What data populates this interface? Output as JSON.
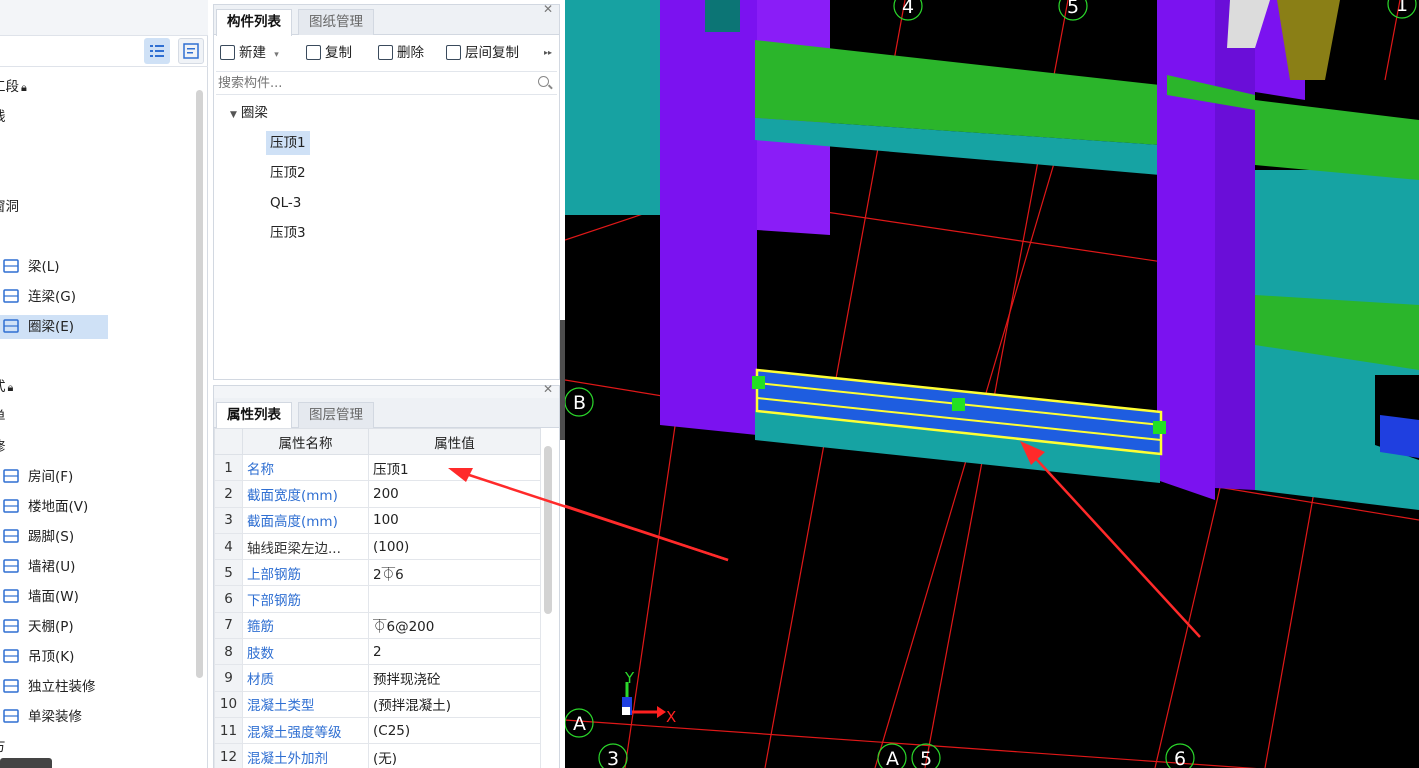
{
  "nav": {
    "header": "",
    "items": [
      {
        "label": "工段",
        "locked": true
      },
      {
        "label": "线"
      },
      {
        "label": "窗洞"
      },
      {
        "label": "梁(L)",
        "icon": "beam-icon"
      },
      {
        "label": "连梁(G)",
        "icon": "coupling-beam-icon"
      },
      {
        "label": "圈梁(E)",
        "icon": "ring-beam-icon",
        "selected": true
      },
      {
        "label": "式",
        "locked": true
      },
      {
        "label": "单"
      },
      {
        "label": "修"
      },
      {
        "label": "房间(F)",
        "icon": "room-icon"
      },
      {
        "label": "楼地面(V)",
        "icon": "floor-icon"
      },
      {
        "label": "踢脚(S)",
        "icon": "skirting-icon"
      },
      {
        "label": "墙裙(U)",
        "icon": "dado-icon"
      },
      {
        "label": "墙面(W)",
        "icon": "wall-face-icon"
      },
      {
        "label": "天棚(P)",
        "icon": "ceiling-icon"
      },
      {
        "label": "吊顶(K)",
        "icon": "suspended-ceiling-icon"
      },
      {
        "label": "独立柱装修",
        "icon": "column-finish-icon"
      },
      {
        "label": "单梁装修",
        "icon": "beam-finish-icon"
      },
      {
        "label": "方"
      }
    ]
  },
  "component_panel": {
    "tabs": [
      {
        "label": "构件列表",
        "active": true
      },
      {
        "label": "图纸管理"
      }
    ],
    "toolbar": {
      "new": "新建",
      "new_arrow": "▾",
      "copy": "复制",
      "delete": "删除",
      "floor_copy": "层间复制",
      "more": "▸▸"
    },
    "search_placeholder": "搜索构件...",
    "tree": {
      "root": "圈梁",
      "children": [
        {
          "label": "压顶1",
          "selected": true
        },
        {
          "label": "压顶2"
        },
        {
          "label": "QL-3"
        },
        {
          "label": "压顶3"
        }
      ]
    }
  },
  "property_panel": {
    "tabs": [
      {
        "label": "属性列表",
        "active": true
      },
      {
        "label": "图层管理"
      }
    ],
    "columns": [
      "属性名称",
      "属性值"
    ],
    "rows": [
      {
        "n": "1",
        "name": "名称",
        "value": "压顶1"
      },
      {
        "n": "2",
        "name": "截面宽度(mm)",
        "value": "200"
      },
      {
        "n": "3",
        "name": "截面高度(mm)",
        "value": "100"
      },
      {
        "n": "4",
        "name": "轴线距梁左边...",
        "value": "(100)",
        "plain": true
      },
      {
        "n": "5",
        "name": "上部钢筋",
        "value": "2⏁6"
      },
      {
        "n": "6",
        "name": "下部钢筋",
        "value": ""
      },
      {
        "n": "7",
        "name": "箍筋",
        "value": "⏁6@200"
      },
      {
        "n": "8",
        "name": "肢数",
        "value": "2"
      },
      {
        "n": "9",
        "name": "材质",
        "value": "预拌现浇砼"
      },
      {
        "n": "10",
        "name": "混凝土类型",
        "value": "(预拌混凝土)"
      },
      {
        "n": "11",
        "name": "混凝土强度等级",
        "value": "(C25)"
      },
      {
        "n": "12",
        "name": "混凝土外加剂",
        "value": "(无)"
      }
    ]
  },
  "viewport": {
    "axis_labels": [
      "4",
      "5",
      "1",
      "B",
      "A",
      "3",
      "A",
      "5",
      "6"
    ],
    "triad_x": "X",
    "triad_y": "Y",
    "colors": {
      "background": "#000000",
      "grid": "#e01818",
      "column": "#7b12f0",
      "beam_top": "#2bb52b",
      "beam_side": "#16a3a3",
      "selected": "#1e5de0",
      "selection_outline": "#ffff33",
      "grip": "#22e022",
      "arrow": "#ff2a2a"
    }
  }
}
